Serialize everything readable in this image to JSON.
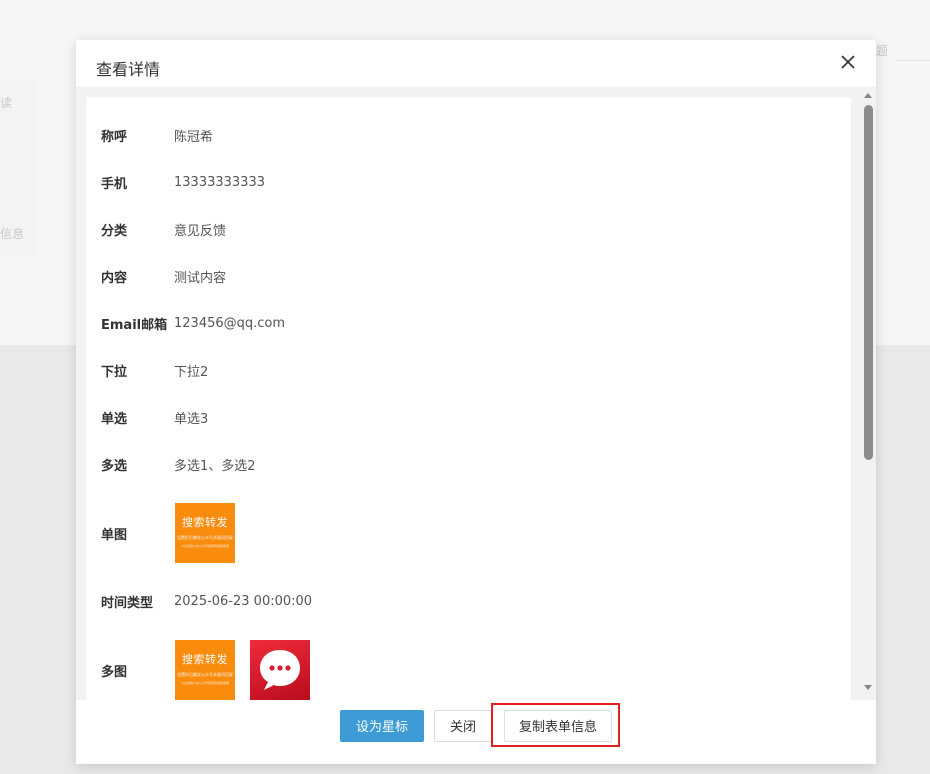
{
  "background": {
    "fragments": [
      "题",
      "读",
      "信息"
    ]
  },
  "modal": {
    "title": "查看详情",
    "fields": [
      {
        "label": "称呼",
        "value": "陈冠希"
      },
      {
        "label": "手机",
        "value": "13333333333"
      },
      {
        "label": "分类",
        "value": "意见反馈"
      },
      {
        "label": "内容",
        "value": "测试内容"
      },
      {
        "label": "Email邮箱",
        "value": "123456@qq.com"
      },
      {
        "label": "下拉",
        "value": "下拉2"
      },
      {
        "label": "单选",
        "value": "单选3"
      },
      {
        "label": "多选",
        "value": "多选1、多选2"
      },
      {
        "label": "单图",
        "value": ""
      },
      {
        "label": "时间类型",
        "value": "2025-06-23 00:00:00"
      },
      {
        "label": "多图",
        "value": ""
      }
    ],
    "image_thumb": {
      "title": "搜索转发",
      "line2": "设置好后触发公众号关键词回复",
      "line3": "以达到用户在公众号搜索转发的效果"
    },
    "footer": {
      "star_label": "设为星标",
      "close_label": "关闭",
      "copy_label": "复制表单信息"
    }
  },
  "colors": {
    "primary": "#3d9bd6",
    "thumb_orange": "#f98b0d",
    "thumb_red": "#d81e2e",
    "highlight": "#e02020"
  },
  "icons": {
    "close": "close-icon",
    "chat": "chat-bubble-icon"
  }
}
